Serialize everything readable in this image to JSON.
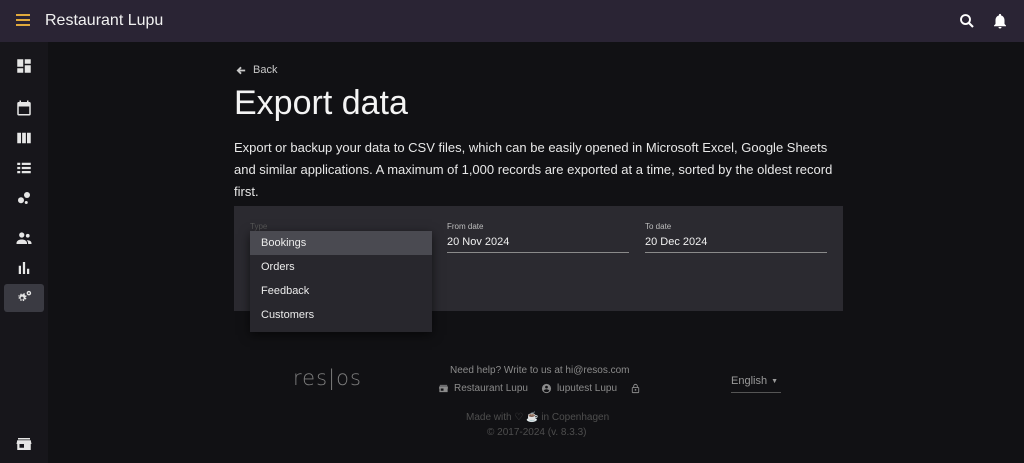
{
  "app": {
    "title": "Restaurant Lupu"
  },
  "nav": {
    "back_label": "Back"
  },
  "page": {
    "title": "Export data",
    "description": "Export or backup your data to CSV files, which can be easily opened in Microsoft Excel, Google Sheets and similar applications. A maximum of 1,000 records are exported at a time, sorted by the oldest record first."
  },
  "form": {
    "type_label": "Type",
    "from_label": "From date",
    "from_value": "20 Nov 2024",
    "to_label": "To date",
    "to_value": "20 Dec 2024"
  },
  "dropdown": {
    "options": [
      "Bookings",
      "Orders",
      "Feedback",
      "Customers"
    ],
    "selected": "Bookings"
  },
  "footer": {
    "logo": "res|os",
    "help": "Need help? Write to us at hi@resos.com",
    "restaurant": "Restaurant Lupu",
    "user": "luputest Lupu",
    "language": "English",
    "made_with": "Made with ♡ ☕ in Copenhagen",
    "copyright": "© 2017-2024 (v. 8.3.3)"
  },
  "colors": {
    "topbar": "#2a2434",
    "accent": "#e0a93c",
    "background": "#111114",
    "panel": "#2b2a30"
  }
}
